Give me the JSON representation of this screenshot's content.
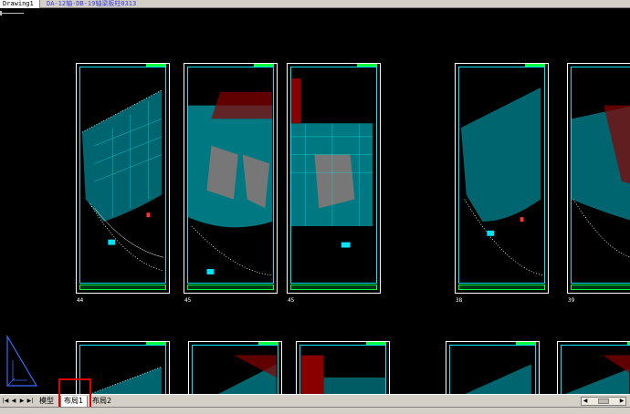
{
  "doc_tabs": [
    {
      "label": "Drawing1",
      "active": true
    },
    {
      "label": "DA-12轴-DB-19轴梁板柱0313",
      "active": false
    }
  ],
  "sheets_top": [
    {
      "number": "44"
    },
    {
      "number": "45"
    },
    {
      "number": "45"
    },
    {
      "number": "38"
    },
    {
      "number": "39"
    }
  ],
  "layout_tabs": [
    {
      "label": "模型"
    },
    {
      "label": "布局1"
    },
    {
      "label": "布局2"
    }
  ],
  "colors": {
    "sheet_frame": "#ffffff",
    "inner_frame": "#00e5ff",
    "title_block": "#00ff3c",
    "hatch": "#00d9d9",
    "highlight": "#e00000"
  }
}
